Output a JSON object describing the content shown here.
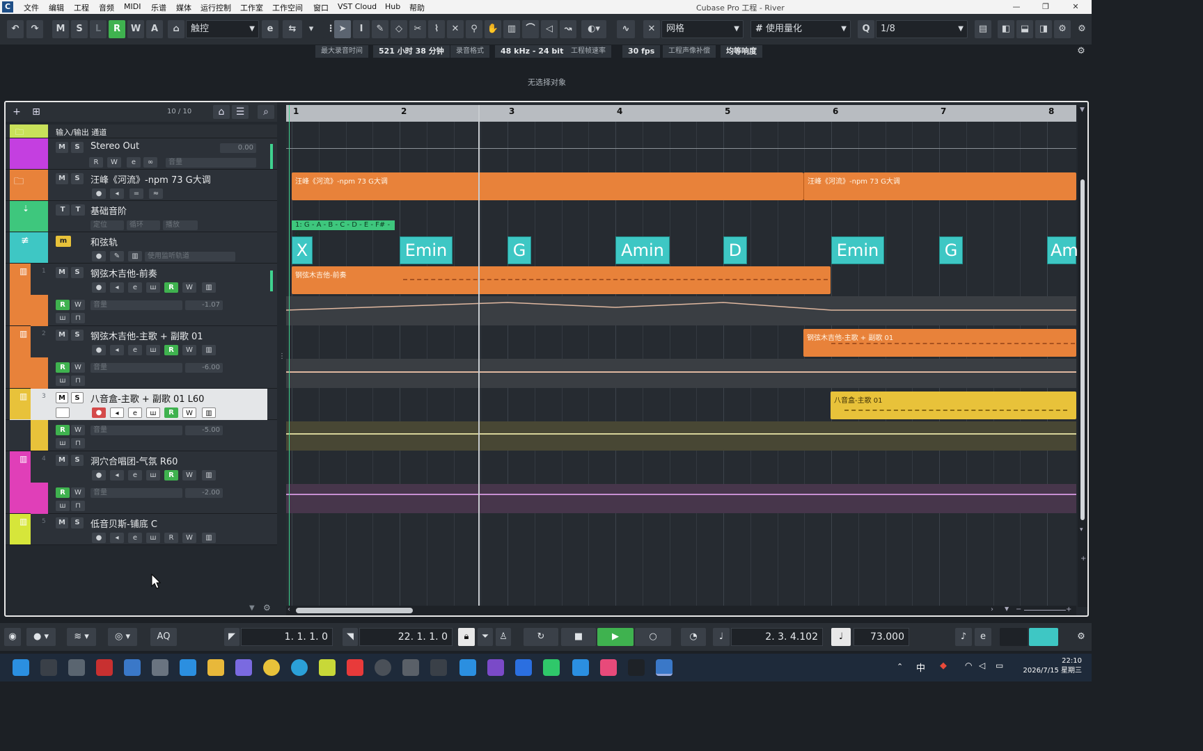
{
  "window": {
    "title": "Cubase Pro 工程 - River"
  },
  "menu": [
    "文件",
    "编辑",
    "工程",
    "音频",
    "MIDI",
    "乐谱",
    "媒体",
    "运行控制",
    "工作室",
    "工作空间",
    "窗口",
    "VST Cloud",
    "Hub",
    "帮助"
  ],
  "toolbar": {
    "undo": "↶",
    "redo": "↷",
    "m": "M",
    "s": "S",
    "l": "L",
    "r": "R",
    "w": "W",
    "a": "A",
    "automation_mode": "触控",
    "snap_type": "网格",
    "quantize_mode": "使用量化",
    "quantize_value": "1/8"
  },
  "infoline": {
    "max_rec_label": "最大录音时间",
    "max_rec_value": "521 小时 38 分钟",
    "rec_format_label": "录音格式",
    "rec_format_value": "48 kHz - 24 bit",
    "frame_rate_label": "工程帧速率",
    "frame_rate_value": "30 fps",
    "pan_law_label": "工程声像补偿",
    "pan_law_value": "均等响度"
  },
  "selection_info": "无选择对象",
  "tracklist": {
    "count": "10 / 10"
  },
  "tracks": [
    {
      "name": "输入/输出 通道",
      "color": "#c9e15a"
    },
    {
      "name": "Stereo Out",
      "color": "#c43fe0",
      "value": "0.00",
      "fader_label": "音量"
    },
    {
      "name": "汪峰《河流》-npm 73 G大调",
      "color": "#e8823a"
    },
    {
      "name": "基础音阶",
      "color": "#3ec77d",
      "btn1": "定位",
      "btn2": "循环",
      "btn3": "播放"
    },
    {
      "name": "和弦轨",
      "color": "#3ec7c4",
      "btn": "使用监听轨道"
    },
    {
      "name": "钢弦木吉他-前奏",
      "num": "1",
      "color": "#e8823a",
      "fader_label": "音量",
      "value": "-1.07"
    },
    {
      "name": "钢弦木吉他-主歌 + 副歌 01",
      "num": "2",
      "color": "#e8823a",
      "fader_label": "音量",
      "value": "-6.00"
    },
    {
      "name": "八音盒-主歌 + 副歌 01 L60",
      "num": "3",
      "color": "#e8c23a",
      "fader_label": "音量",
      "value": "-5.00"
    },
    {
      "name": "洞穴合唱团-气氛 R60",
      "num": "4",
      "color": "#e03fb8",
      "fader_label": "音量",
      "value": "-2.00"
    },
    {
      "name": "低音贝斯-铺底 C",
      "num": "5",
      "color": "#d6e63a"
    }
  ],
  "ruler": [
    "1",
    "2",
    "3",
    "4",
    "5",
    "6",
    "7",
    "8"
  ],
  "clips": {
    "folder_a": "汪峰《河流》-npm 73 G大调",
    "folder_b": "汪峰《河流》-npm 73 G大调",
    "scale": "1: G - A - B - C - D - E - F# - G",
    "guitar_intro": "钢弦木吉他-前奏",
    "guitar_verse": "钢弦木吉他-主歌 + 副歌 01",
    "musicbox": "八音盒-主歌 01"
  },
  "chords": [
    "X",
    "Emin",
    "G",
    "Amin",
    "D",
    "Emin",
    "G",
    "Am"
  ],
  "transport": {
    "left_locator": "1. 1. 1.    0",
    "right_locator": "22. 1. 1.    0",
    "position": "2. 3. 4.102",
    "tempo": "73.000",
    "aq": "AQ"
  },
  "clock": {
    "time": "22:10",
    "date": "2026/7/15 星期三"
  },
  "taskbar_tray": {
    "ime": "中"
  }
}
